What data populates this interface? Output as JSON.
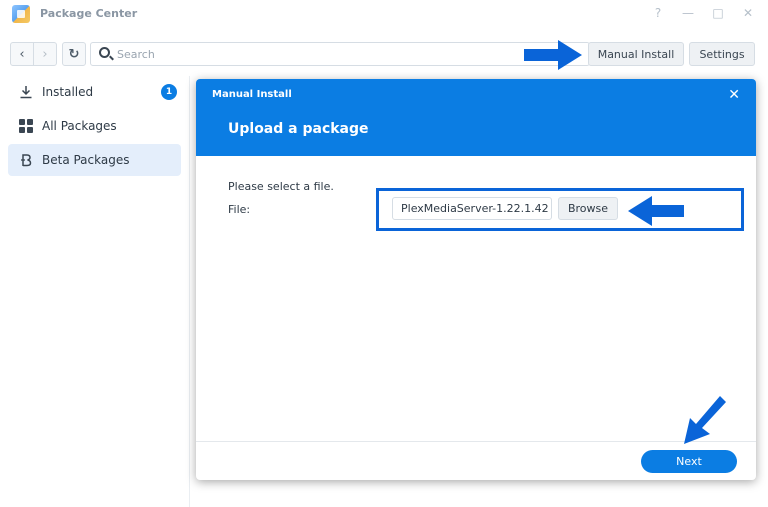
{
  "window": {
    "title": "Package Center",
    "controls": [
      "?",
      "—",
      "□",
      "✕"
    ]
  },
  "toolbar": {
    "search_placeholder": "Search",
    "manual_install_label": "Manual Install",
    "settings_label": "Settings"
  },
  "sidebar": {
    "items": [
      {
        "label": "Installed",
        "icon": "download-icon",
        "badge": "1"
      },
      {
        "label": "All Packages",
        "icon": "grid-icon"
      },
      {
        "label": "Beta Packages",
        "icon": "beta-icon",
        "active": true
      }
    ]
  },
  "dialog": {
    "title": "Manual Install",
    "heading": "Upload a package",
    "instruction": "Please select a file.",
    "file_label": "File:",
    "file_value": "PlexMediaServer-1.22.1.42",
    "browse_label": "Browse",
    "next_label": "Next",
    "close_icon": "close-icon"
  },
  "colors": {
    "accent": "#0b7de3",
    "annotation": "#0a64d8",
    "sidebar_active": "#e4eefb"
  }
}
